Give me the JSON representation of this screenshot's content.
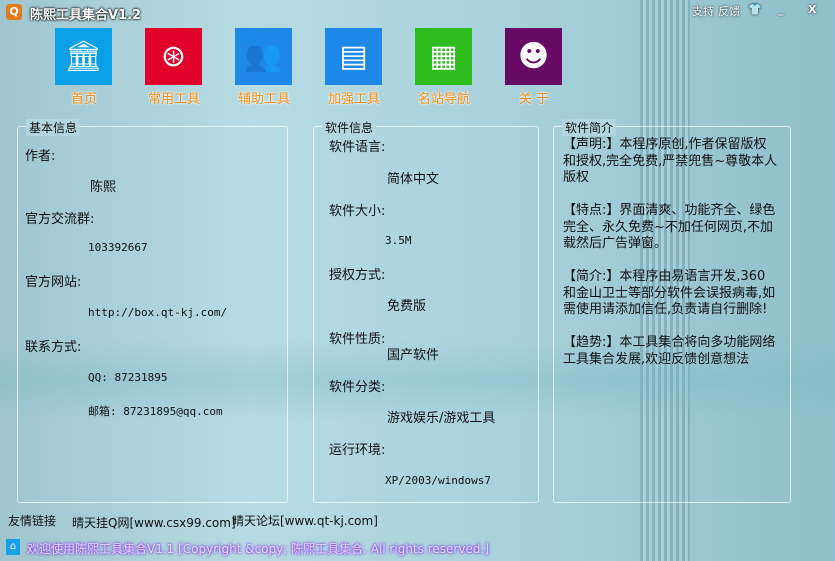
{
  "window": {
    "title": "陈熙工具集合V1.2",
    "buttons": {
      "support": "支持",
      "feedback": "反馈",
      "skin": "👕",
      "minimize": "_",
      "close": "X"
    }
  },
  "nav": [
    {
      "label": "首页",
      "icon": "bank-icon",
      "color": "#0aa0e8",
      "glyph": "🏛"
    },
    {
      "label": "常用工具",
      "icon": "flame-icon",
      "color": "#e0002a",
      "glyph": "⊛"
    },
    {
      "label": "辅助工具",
      "icon": "users-icon",
      "color": "#1e88e8",
      "glyph": "👥"
    },
    {
      "label": "加强工具",
      "icon": "documents-icon",
      "color": "#1e88e8",
      "glyph": "▤"
    },
    {
      "label": "名站导航",
      "icon": "creeper-icon",
      "color": "#2ebc1e",
      "glyph": "▦"
    },
    {
      "label": "关 于",
      "icon": "smiley-icon",
      "color": "#660a66",
      "glyph": "☻"
    }
  ],
  "basic": {
    "title": "基本信息",
    "author_label": "作者:",
    "author": "陈熙",
    "group_label": "官方交流群:",
    "group": "103392667",
    "site_label": "官方网站:",
    "site": "http://box.qt-kj.com/",
    "contact_label": "联系方式:",
    "qq": "QQ: 87231895",
    "email": "邮箱: 87231895@qq.com"
  },
  "software": {
    "title": "软件信息",
    "lang_label": "软件语言:",
    "lang": "简体中文",
    "size_label": "软件大小:",
    "size": "3.5M",
    "license_label": "授权方式:",
    "license": "免费版",
    "nature_label": "软件性质:",
    "nature": "国产软件",
    "category_label": "软件分类:",
    "category": "游戏娱乐/游戏工具",
    "env_label": "运行环境:",
    "env": "XP/2003/windows7"
  },
  "intro": {
    "title": "软件简介",
    "paragraphs": [
      "【声明:】本程序原创,作者保留版权和授权,完全免费,严禁兜售~尊敬本人版权",
      "【特点:】界面清爽、功能齐全、绿色完全、永久免费~不加任何网页,不加载然后广告弹窗。",
      "【简介:】本程序由易语言开发,360和金山卫士等部分软件会误报病毒,如需使用请添加信任,负责请自行删除!",
      "【趋势:】本工具集合将向多功能网络工具集合发展,欢迎反馈创意想法"
    ]
  },
  "links": {
    "label": "友情链接",
    "items": [
      "晴天挂Q网[www.csx99.com]",
      "晴天论坛[www.qt-kj.com]"
    ]
  },
  "status": {
    "message": "欢迎使用陈熙工具集合V1.1  [Copyright &copy; 陈熙工具集合. All rights reserved.]"
  }
}
